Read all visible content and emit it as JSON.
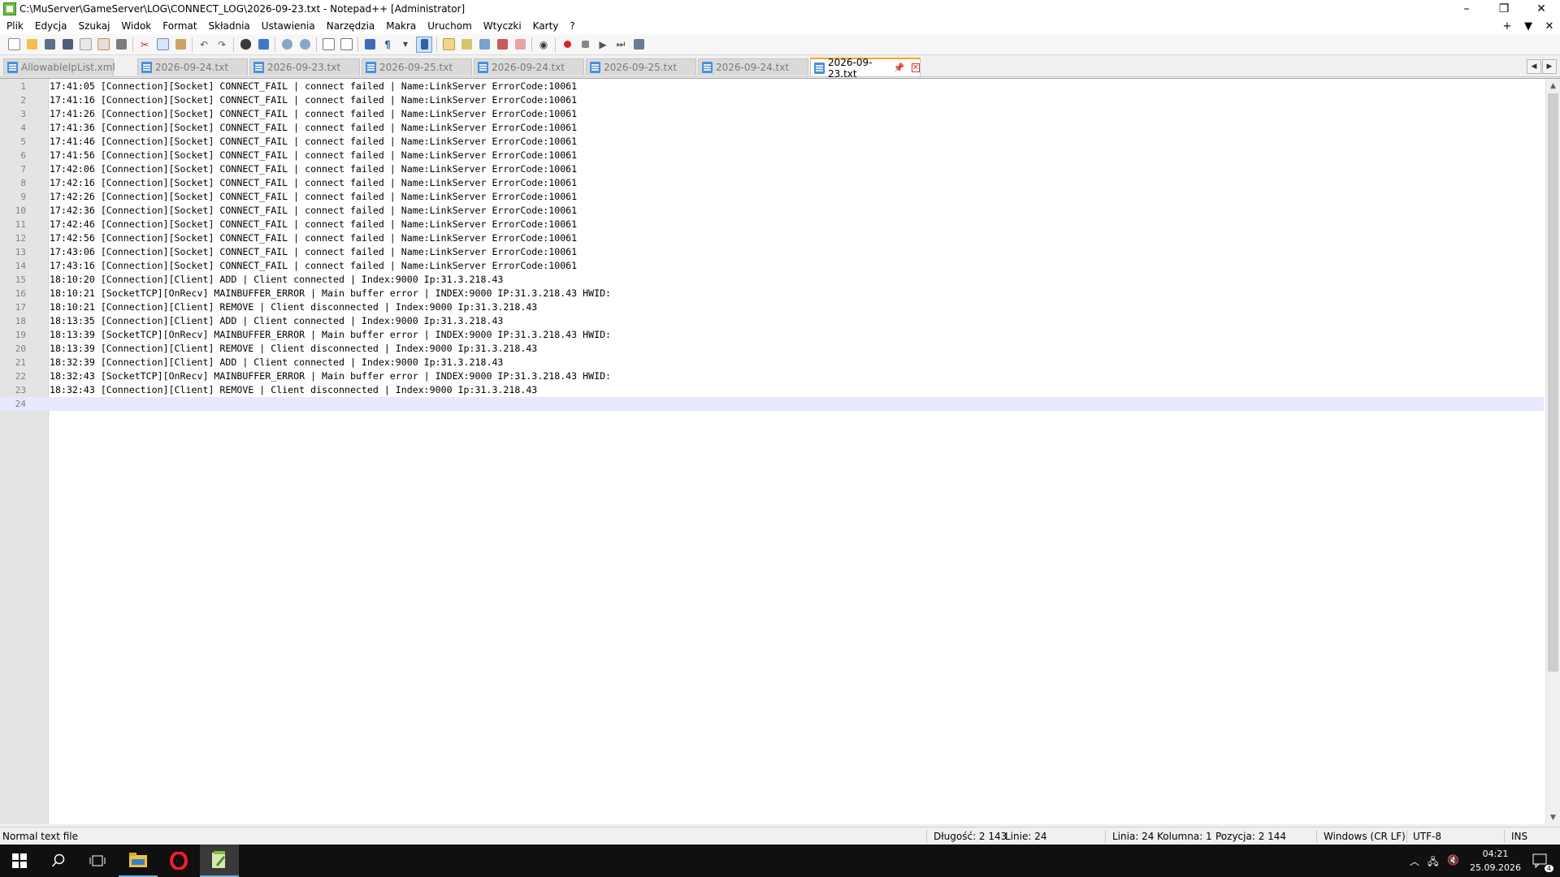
{
  "window": {
    "title": "C:\\MuServer\\GameServer\\LOG\\CONNECT_LOG\\2026-09-23.txt - Notepad++ [Administrator]",
    "minimize": "–",
    "restore": "❐",
    "close": "✕"
  },
  "menu": {
    "items": [
      "Plik",
      "Edycja",
      "Szukaj",
      "Widok",
      "Format",
      "Składnia",
      "Ustawienia",
      "Narzędzia",
      "Makra",
      "Uruchom",
      "Wtyczki",
      "Karty",
      "?"
    ],
    "right": [
      "+",
      "▼",
      "✕"
    ]
  },
  "toolbar": {
    "icons": [
      "new-file-icon",
      "open-file-icon",
      "save-icon",
      "save-all-icon",
      "close-icon",
      "close-all-icon",
      "print-icon",
      "cut-icon",
      "copy-icon",
      "paste-icon",
      "undo-icon",
      "redo-icon",
      "find-icon",
      "replace-icon",
      "zoom-in-icon",
      "zoom-out-icon",
      "sync-vertical-icon",
      "sync-horizontal-icon",
      "word-wrap-icon",
      "show-all-chars-icon",
      "indent-guide-icon",
      "doc-map-icon",
      "function-list-icon",
      "folder-workspace-icon",
      "monitoring-icon",
      "start-record-icon",
      "stop-record-icon",
      "playback-icon",
      "run-macro-multiple-icon",
      "save-macro-icon"
    ]
  },
  "tabs": [
    {
      "label": "AllowableIpList.xml",
      "active": false
    },
    {
      "label": "2026-09-24.txt",
      "active": false
    },
    {
      "label": "2026-09-23.txt",
      "active": false
    },
    {
      "label": "2026-09-25.txt",
      "active": false
    },
    {
      "label": "2026-09-24.txt",
      "active": false
    },
    {
      "label": "2026-09-25.txt",
      "active": false
    },
    {
      "label": "2026-09-24.txt",
      "active": false
    },
    {
      "label": "2026-09-23.txt",
      "active": true
    }
  ],
  "editor": {
    "current_line": 24,
    "lines": [
      "17:41:05 [Connection][Socket] CONNECT_FAIL | connect failed | Name:LinkServer ErrorCode:10061",
      "17:41:16 [Connection][Socket] CONNECT_FAIL | connect failed | Name:LinkServer ErrorCode:10061",
      "17:41:26 [Connection][Socket] CONNECT_FAIL | connect failed | Name:LinkServer ErrorCode:10061",
      "17:41:36 [Connection][Socket] CONNECT_FAIL | connect failed | Name:LinkServer ErrorCode:10061",
      "17:41:46 [Connection][Socket] CONNECT_FAIL | connect failed | Name:LinkServer ErrorCode:10061",
      "17:41:56 [Connection][Socket] CONNECT_FAIL | connect failed | Name:LinkServer ErrorCode:10061",
      "17:42:06 [Connection][Socket] CONNECT_FAIL | connect failed | Name:LinkServer ErrorCode:10061",
      "17:42:16 [Connection][Socket] CONNECT_FAIL | connect failed | Name:LinkServer ErrorCode:10061",
      "17:42:26 [Connection][Socket] CONNECT_FAIL | connect failed | Name:LinkServer ErrorCode:10061",
      "17:42:36 [Connection][Socket] CONNECT_FAIL | connect failed | Name:LinkServer ErrorCode:10061",
      "17:42:46 [Connection][Socket] CONNECT_FAIL | connect failed | Name:LinkServer ErrorCode:10061",
      "17:42:56 [Connection][Socket] CONNECT_FAIL | connect failed | Name:LinkServer ErrorCode:10061",
      "17:43:06 [Connection][Socket] CONNECT_FAIL | connect failed | Name:LinkServer ErrorCode:10061",
      "17:43:16 [Connection][Socket] CONNECT_FAIL | connect failed | Name:LinkServer ErrorCode:10061",
      "18:10:20 [Connection][Client] ADD | Client connected | Index:9000 Ip:31.3.218.43",
      "18:10:21 [SocketTCP][OnRecv] MAINBUFFER_ERROR | Main buffer error | INDEX:9000 IP:31.3.218.43 HWID:",
      "18:10:21 [Connection][Client] REMOVE | Client disconnected | Index:9000 Ip:31.3.218.43",
      "18:13:35 [Connection][Client] ADD | Client connected | Index:9000 Ip:31.3.218.43",
      "18:13:39 [SocketTCP][OnRecv] MAINBUFFER_ERROR | Main buffer error | INDEX:9000 IP:31.3.218.43 HWID:",
      "18:13:39 [Connection][Client] REMOVE | Client disconnected | Index:9000 Ip:31.3.218.43",
      "18:32:39 [Connection][Client] ADD | Client connected | Index:9000 Ip:31.3.218.43",
      "18:32:43 [SocketTCP][OnRecv] MAINBUFFER_ERROR | Main buffer error | INDEX:9000 IP:31.3.218.43 HWID:",
      "18:32:43 [Connection][Client] REMOVE | Client disconnected | Index:9000 Ip:31.3.218.43",
      ""
    ]
  },
  "status": {
    "file_type": "Normal text file",
    "length": "Długość: 2 143",
    "lines": "Linie: 24",
    "line": "Linia: 24",
    "column": "Kolumna: 1",
    "position": "Pozycja: 2 144",
    "eol": "Windows (CR LF)",
    "encoding": "UTF-8",
    "mode": "INS"
  },
  "taskbar": {
    "time": "04:21",
    "date": "25.09.2026",
    "notifications": "4"
  }
}
